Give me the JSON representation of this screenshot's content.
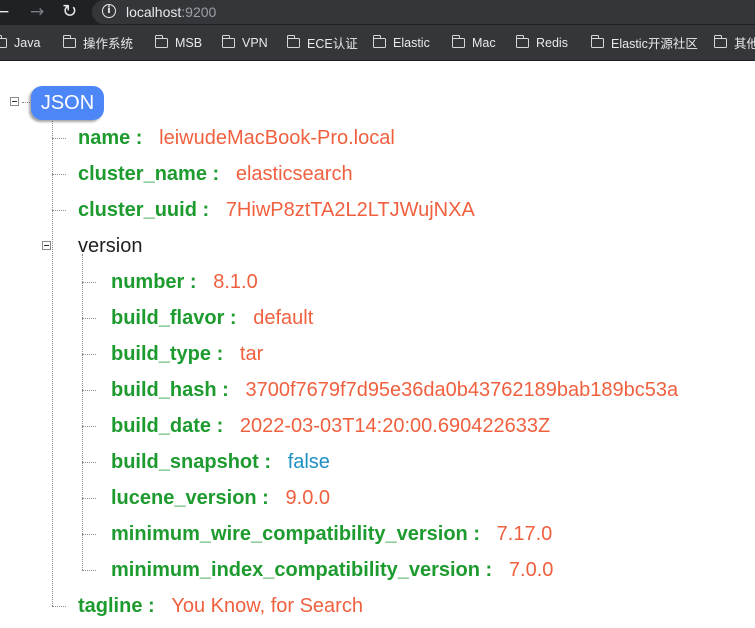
{
  "browser": {
    "back_icon": "arrow-left-icon",
    "forward_icon": "arrow-right-icon",
    "reload_icon": "reload-icon",
    "info_icon": "info-icon",
    "url_host": "localhost",
    "url_port": ":9200"
  },
  "bookmarks": [
    "Java",
    "操作系统",
    "MSB",
    "VPN",
    "ECE认证",
    "Elastic",
    "Mac",
    "Redis",
    "Elastic开源社区",
    "其他"
  ],
  "tree": {
    "root_label": "JSON",
    "name": {
      "key": "name",
      "value": "leiwudeMacBook-Pro.local"
    },
    "cluster_name": {
      "key": "cluster_name",
      "value": "elasticsearch"
    },
    "cluster_uuid": {
      "key": "cluster_uuid",
      "value": "7HiwP8ztTA2L2LTJWujNXA"
    },
    "version": {
      "key": "version",
      "number": {
        "key": "number",
        "value": "8.1.0"
      },
      "build_flavor": {
        "key": "build_flavor",
        "value": "default"
      },
      "build_type": {
        "key": "build_type",
        "value": "tar"
      },
      "build_hash": {
        "key": "build_hash",
        "value": "3700f7679f7d95e36da0b43762189bab189bc53a"
      },
      "build_date": {
        "key": "build_date",
        "value": "2022-03-03T14:20:00.690422633Z"
      },
      "build_snapshot": {
        "key": "build_snapshot",
        "value": "false"
      },
      "lucene_version": {
        "key": "lucene_version",
        "value": "9.0.0"
      },
      "minimum_wire_compatibility_version": {
        "key": "minimum_wire_compatibility_version",
        "value": "7.17.0"
      },
      "minimum_index_compatibility_version": {
        "key": "minimum_index_compatibility_version",
        "value": "7.0.0"
      }
    },
    "tagline": {
      "key": "tagline",
      "value": "You Know, for Search"
    },
    "colors": {
      "key": "#1e9b2f",
      "string": "#f0603f",
      "boolean": "#1d8fc5",
      "root_pill": "#4d86f6"
    }
  }
}
